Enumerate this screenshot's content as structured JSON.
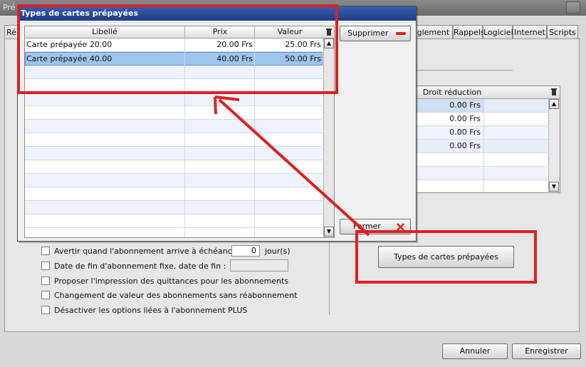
{
  "background_window": {
    "title": "Pré",
    "tab_left": "Ré",
    "tabs": [
      "èglement",
      "Rappels",
      "Logiciel",
      "Internet",
      "Scripts"
    ]
  },
  "right_grid": {
    "header": "Droit réduction",
    "rows": [
      "0.00 Frs",
      "0.00 Frs",
      "0.00 Frs",
      "0.00 Frs"
    ]
  },
  "options": [
    {
      "label": "Avertir quand l'abonnement arrive à échéance :",
      "value": "0",
      "suffix": "jour(s)"
    },
    {
      "label": "Date de fin d'abonnement fixe, date de fin  :",
      "value": ""
    },
    {
      "label": "Proposer l'impression des quittances pour les abonnements"
    },
    {
      "label": "Changement de valeur des abonnements sans réabonnement"
    },
    {
      "label": "Désactiver les options liées à l'abonnement PLUS"
    }
  ],
  "types_button_label": "Types de cartes prépayées",
  "footer": {
    "cancel": "Annuler",
    "save": "Enregistrer"
  },
  "dialog": {
    "title": "Types de cartes prépayées",
    "columns": [
      "Libellé",
      "Prix",
      "Valeur"
    ],
    "rows": [
      {
        "libelle": "Carte prépayée 20.00",
        "prix": "20.00 Frs",
        "valeur": "25.00 Frs"
      },
      {
        "libelle": "Carte prépayée 40.00",
        "prix": "40.00 Frs",
        "valeur": "50.00 Frs"
      }
    ],
    "delete_label": "Supprimer",
    "close_label": "Fermer"
  },
  "colors": {
    "annotation": "#e02020",
    "selection": "#9ec6ec",
    "title_bar": "#1d3d86"
  }
}
